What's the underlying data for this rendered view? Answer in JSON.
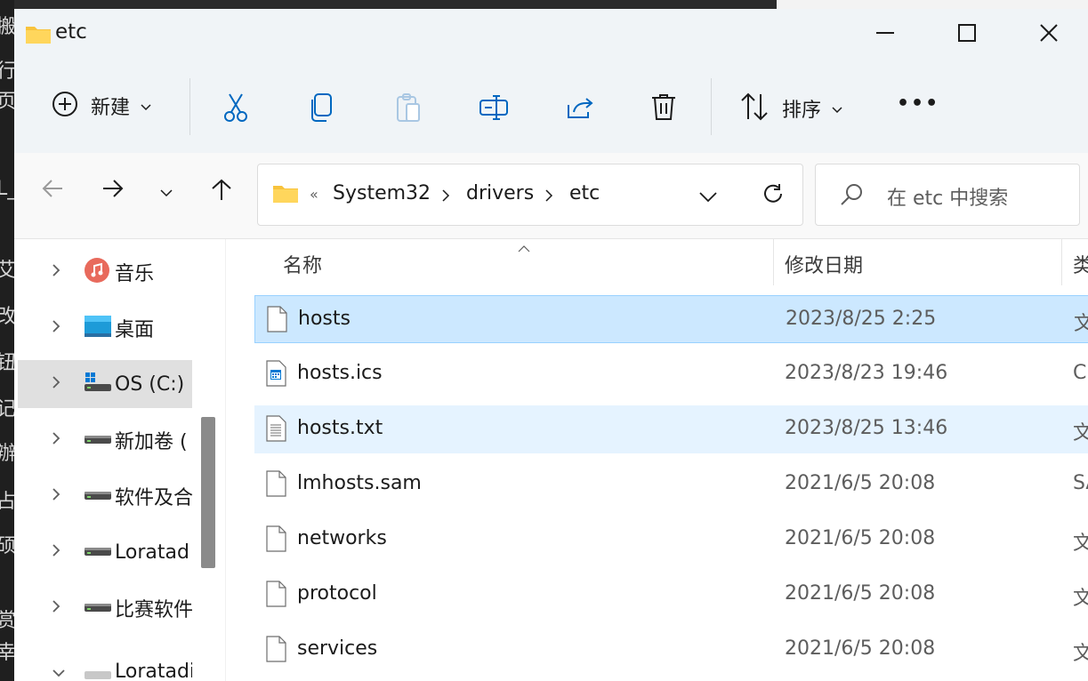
{
  "window": {
    "title": "etc"
  },
  "toolbar": {
    "new_label": "新建",
    "sort_label": "排序",
    "more_label": "•••"
  },
  "address": {
    "overflow": "«",
    "segments": [
      "System32",
      "drivers",
      "etc"
    ]
  },
  "search": {
    "placeholder": "在 etc 中搜索"
  },
  "sidebar": {
    "items": [
      {
        "label": "音乐",
        "icon": "music-icon"
      },
      {
        "label": "桌面",
        "icon": "desktop-icon"
      },
      {
        "label": "OS (C:)",
        "icon": "windows-drive-icon",
        "selected": true
      },
      {
        "label": "新加卷 (",
        "icon": "drive-icon"
      },
      {
        "label": "软件及合",
        "icon": "drive-icon"
      },
      {
        "label": "Loratad",
        "icon": "drive-icon"
      },
      {
        "label": "比赛软件",
        "icon": "drive-icon"
      },
      {
        "label": "Loratadin",
        "icon": "drive-icon"
      }
    ]
  },
  "columns": {
    "name": "名称",
    "date": "修改日期",
    "type": "类"
  },
  "files": [
    {
      "name": "hosts",
      "date": "2023/8/25 2:25",
      "type": "文",
      "icon": "file-icon",
      "state": "selected"
    },
    {
      "name": "hosts.ics",
      "date": "2023/8/23 19:46",
      "type": "C",
      "icon": "calendar-file-icon"
    },
    {
      "name": "hosts.txt",
      "date": "2023/8/25 13:46",
      "type": "文",
      "icon": "text-file-icon",
      "state": "hover"
    },
    {
      "name": "lmhosts.sam",
      "date": "2021/6/5 20:08",
      "type": "SA",
      "icon": "file-icon"
    },
    {
      "name": "networks",
      "date": "2021/6/5 20:08",
      "type": "文",
      "icon": "file-icon"
    },
    {
      "name": "protocol",
      "date": "2021/6/5 20:08",
      "type": "文",
      "icon": "file-icon"
    },
    {
      "name": "services",
      "date": "2021/6/5 20:08",
      "type": "文",
      "icon": "file-icon"
    }
  ],
  "background_text": [
    "搬",
    "行",
    "页",
    "L_",
    "艾",
    "改",
    "钮",
    "记",
    "辦",
    "占",
    "硕",
    "赏",
    "幸"
  ],
  "colors": {
    "selection": "#cce8ff",
    "selection_border": "#99d1ff",
    "hover": "#e5f3ff",
    "accent": "#0067c0"
  }
}
